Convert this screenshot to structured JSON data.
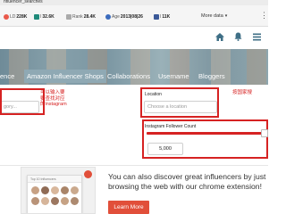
{
  "browser": {
    "url": "nfluencer_searches"
  },
  "seo_toolbar": {
    "metrics": [
      {
        "label": "LD",
        "value": "228K",
        "color": "#e9594a"
      },
      {
        "label": "I",
        "value": "32.6K",
        "color": "#1f8a7a"
      },
      {
        "label": "Rank",
        "value": "28.4K",
        "color": "#aaaaaa"
      },
      {
        "label": "Age",
        "value": "2013|08|26",
        "color": "#3b6bbd"
      },
      {
        "label": "I",
        "value": "11K",
        "color": "#3b5998"
      }
    ],
    "more_data_label": "More data",
    "menu_dots": "⋮"
  },
  "header": {
    "icons": [
      "home-icon",
      "bell-icon",
      "menu-icon"
    ]
  },
  "tabs": {
    "items": [
      "ence",
      "Amazon Influencer Shops",
      "Collaborations",
      "Username",
      "Bloggers"
    ],
    "active_index": 1,
    "active_color": "#8fa9b4"
  },
  "search": {
    "category_placeholder": "gory...",
    "category_annotation_line1": "可以输入要",
    "category_annotation_line2": "要查找对应",
    "category_annotation_line3": "的instagram",
    "location_label": "Location",
    "location_placeholder": "Choose a location",
    "location_annotation": "按国家搜",
    "follower_label": "Instagram Follower Count",
    "follower_min_value": "5,000",
    "accent_color": "#d62222"
  },
  "promo": {
    "text": "You can also discover great influencers by just browsing the web with our chrome extension!",
    "button_label": "Learn More",
    "button_color": "#e14f3a",
    "thumbnail_title": "Top 10 Influencers"
  }
}
